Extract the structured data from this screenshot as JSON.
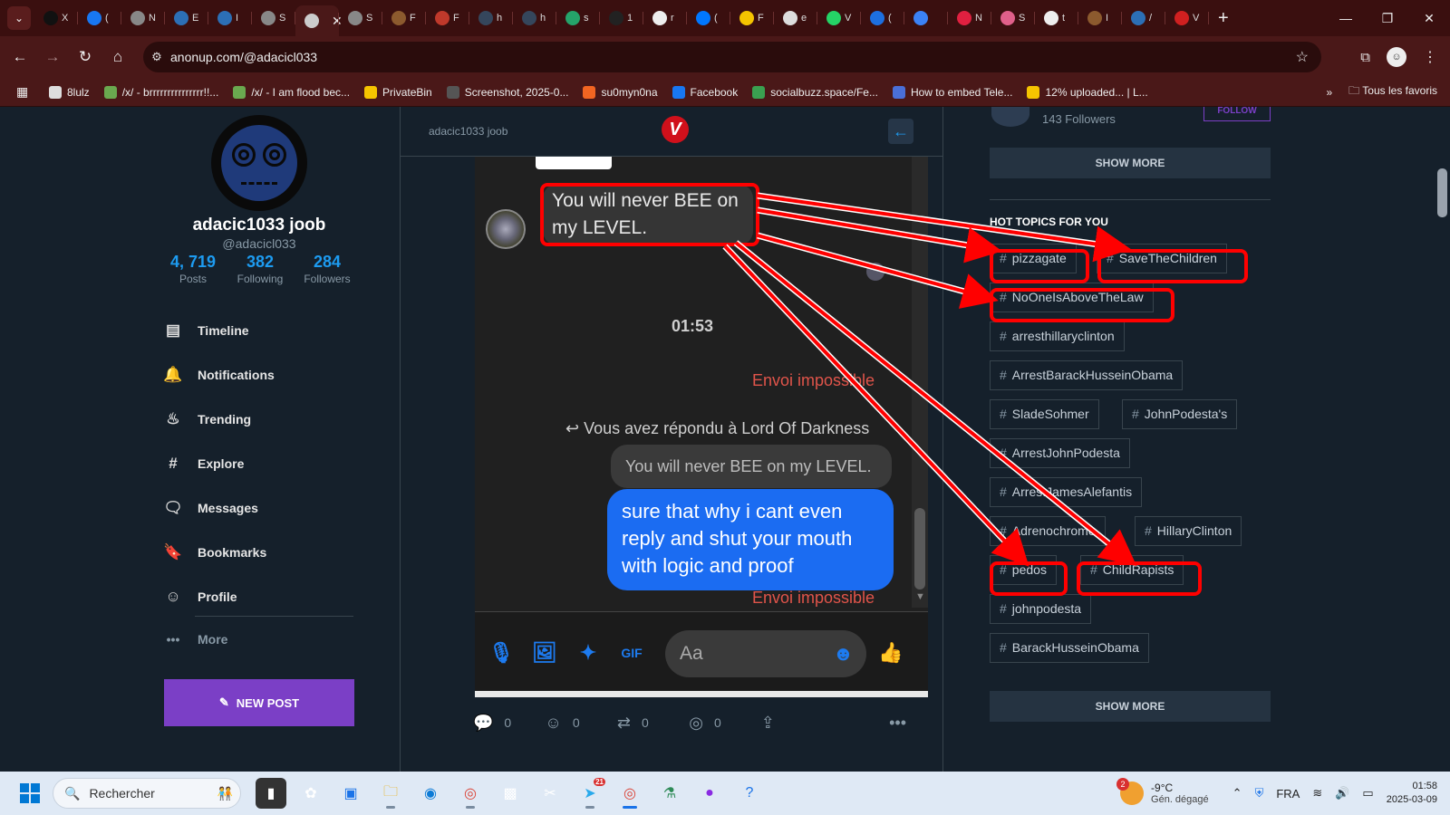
{
  "browser": {
    "tabs": [
      {
        "title": "X",
        "color": "#111111"
      },
      {
        "title": "(",
        "color": "#1877f2"
      },
      {
        "title": "N",
        "color": "#888888"
      },
      {
        "title": "E",
        "color": "#2c6fb6"
      },
      {
        "title": "I",
        "color": "#2c6fb6"
      },
      {
        "title": "S",
        "color": "#888888"
      },
      {
        "title": "a",
        "color": "#cccccc",
        "active": true
      },
      {
        "title": "S",
        "color": "#888888"
      },
      {
        "title": "F",
        "color": "#8c5a2e"
      },
      {
        "title": "F",
        "color": "#c0392b"
      },
      {
        "title": "h",
        "color": "#35465c"
      },
      {
        "title": "h",
        "color": "#35465c"
      },
      {
        "title": "s",
        "color": "#25a36a"
      },
      {
        "title": "1",
        "color": "#222222"
      },
      {
        "title": "r",
        "color": "#eeeeee"
      },
      {
        "title": "(",
        "color": "#0077ff"
      },
      {
        "title": "F",
        "color": "#f5c400"
      },
      {
        "title": "e",
        "color": "#dddddd"
      },
      {
        "title": "V",
        "color": "#25d366"
      },
      {
        "title": "(",
        "color": "#1d6fe0"
      },
      {
        "title": "",
        "color": "#3b82f6"
      },
      {
        "title": "N",
        "color": "#e02040"
      },
      {
        "title": "S",
        "color": "#e0608a"
      },
      {
        "title": "t",
        "color": "#eeeeee"
      },
      {
        "title": "I",
        "color": "#8c5a2e"
      },
      {
        "title": "/",
        "color": "#2c6fb6"
      },
      {
        "title": "V",
        "color": "#d02020"
      }
    ],
    "url": "anonup.com/@adacicl033",
    "bookmarks": [
      {
        "label": "8lulz",
        "color": "#dddddd"
      },
      {
        "label": "/x/ - brrrrrrrrrrrrrrr!!...",
        "color": "#6aa84f"
      },
      {
        "label": "/x/ - I am flood bec...",
        "color": "#6aa84f"
      },
      {
        "label": "PrivateBin",
        "color": "#f5c400"
      },
      {
        "label": "Screenshot, 2025-0...",
        "color": "#555555"
      },
      {
        "label": "su0myn0na",
        "color": "#f26522"
      },
      {
        "label": "Facebook",
        "color": "#1877f2"
      },
      {
        "label": "socialbuzz.space/Fe...",
        "color": "#3aa050"
      },
      {
        "label": "How to embed Tele...",
        "color": "#4a6fd8"
      },
      {
        "label": "12% uploaded... | L...",
        "color": "#f5c400"
      }
    ],
    "all_bookmarks": "Tous les favoris"
  },
  "profile": {
    "name": "adacic1033 joob",
    "handle": "@adacicl033",
    "stats": [
      {
        "value": "4, 719",
        "label": "Posts"
      },
      {
        "value": "382",
        "label": "Following"
      },
      {
        "value": "284",
        "label": "Followers"
      }
    ]
  },
  "nav": [
    {
      "label": "Timeline",
      "icon": "timeline-icon",
      "glyph": "▤"
    },
    {
      "label": "Notifications",
      "icon": "bell-icon",
      "glyph": "🔔"
    },
    {
      "label": "Trending",
      "icon": "flame-icon",
      "glyph": "♨"
    },
    {
      "label": "Explore",
      "icon": "hash-icon",
      "glyph": "#"
    },
    {
      "label": "Messages",
      "icon": "chat-icon",
      "glyph": "🗨"
    },
    {
      "label": "Bookmarks",
      "icon": "bookmark-icon",
      "glyph": "🔖"
    },
    {
      "label": "Profile",
      "icon": "profile-icon",
      "glyph": "☺"
    }
  ],
  "nav_more": "More",
  "new_post": "NEW POST",
  "post": {
    "author": "adacic1033 joob",
    "logo_letter": "V",
    "chat": {
      "incoming_line1": "You will never BEE on",
      "incoming_line2": "my LEVEL.",
      "time": "01:53",
      "failed": "Envoi impossible",
      "replied_to": "Vous avez répondu à Lord Of Darkness",
      "quote": "You will never BEE on my LEVEL.",
      "outgoing_line1": "sure that why i cant even",
      "outgoing_line2": "reply and shut your mouth",
      "outgoing_line3": "with logic and proof",
      "failed2": "Envoi impossible",
      "input_placeholder": "Aa"
    },
    "actions": [
      {
        "icon": "comment-icon",
        "glyph": "💬",
        "count": "0"
      },
      {
        "icon": "reaction-icon",
        "glyph": "☺",
        "count": "0"
      },
      {
        "icon": "repost-icon",
        "glyph": "⇄",
        "count": "0"
      },
      {
        "icon": "target-icon",
        "glyph": "◎",
        "count": "0"
      },
      {
        "icon": "share-icon",
        "glyph": "⇪",
        "count": ""
      },
      {
        "icon": "more-icon",
        "glyph": "•••",
        "count": ""
      }
    ]
  },
  "right": {
    "followers_text": "143 Followers",
    "follow_btn": "FOLLOW",
    "show_more": "SHOW MORE",
    "hot_title": "HOT TOPICS FOR YOU",
    "tags": [
      "pizzagate",
      "SaveTheChildren",
      "NoOneIsAboveTheLaw",
      "arresthillaryclinton",
      "ArrestBarackHusseinObama",
      "SladeSohmer",
      "JohnPodesta's",
      "ArrestJohnPodesta",
      "ArrestJamesAlefantis",
      "Adrenochrome",
      "HillaryClinton",
      "pedos",
      "ChildRapists",
      "johnpodesta",
      "BarackHusseinObama"
    ],
    "show_more2": "SHOW MORE"
  },
  "annotation_color": "#ff0000",
  "taskbar": {
    "search": "Rechercher",
    "weather_badge": "2",
    "temp": "-9°C",
    "weather": "Gén. dégagé",
    "lang": "FRA",
    "time": "01:58",
    "date": "2025-03-09",
    "telegram_badge": "21"
  }
}
